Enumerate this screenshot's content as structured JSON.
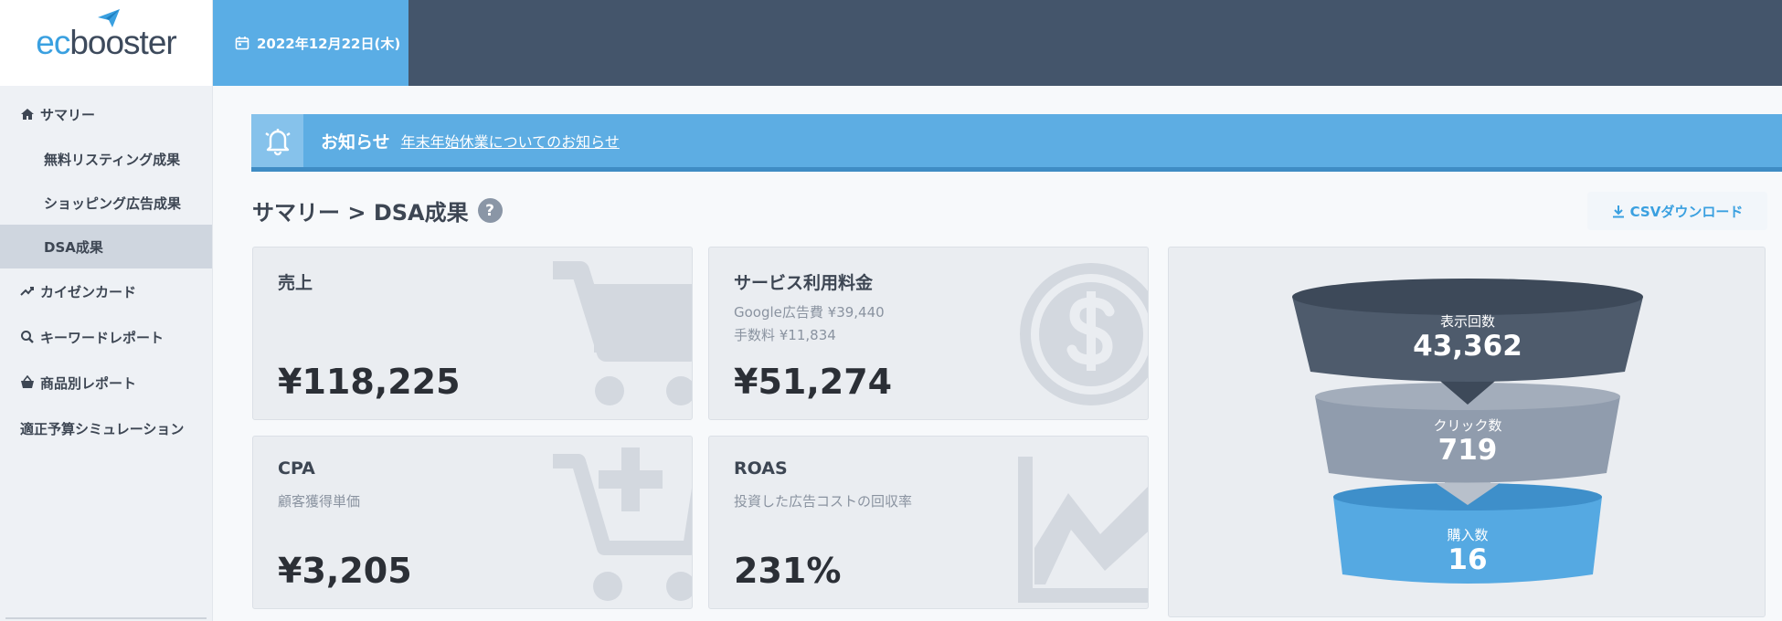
{
  "logo": {
    "part1": "ec",
    "part2": "booster"
  },
  "header": {
    "date": "2022年12月22日(木)"
  },
  "sidebar": {
    "items": [
      {
        "label": "サマリー",
        "icon": "home-icon"
      },
      {
        "label": "無料リスティング成果"
      },
      {
        "label": "ショッピング広告成果"
      },
      {
        "label": "DSA成果",
        "active": true
      },
      {
        "label": "カイゼンカード",
        "icon": "trend-icon"
      },
      {
        "label": "キーワードレポート",
        "icon": "search-icon"
      },
      {
        "label": "商品別レポート",
        "icon": "basket-icon"
      },
      {
        "label": "適正予算シミュレーション"
      }
    ]
  },
  "notice": {
    "title": "お知らせ",
    "link": "年末年始休業についてのお知らせ"
  },
  "page": {
    "title": "サマリー > DSA成果",
    "help": "?",
    "csv_label": "CSVダウンロード"
  },
  "cards": {
    "sales": {
      "label": "売上",
      "value": "¥118,225"
    },
    "service": {
      "label": "サービス利用料金",
      "sub1": "Google広告費 ¥39,440",
      "sub2": "手数料 ¥11,834",
      "value": "¥51,274"
    },
    "cpa": {
      "label": "CPA",
      "sub1": "顧客獲得単価",
      "value": "¥3,205"
    },
    "roas": {
      "label": "ROAS",
      "sub1": "投資した広告コストの回収率",
      "value": "231%"
    }
  },
  "funnel": {
    "impressions": {
      "label": "表示回数",
      "value": "43,362"
    },
    "clicks": {
      "label": "クリック数",
      "value": "719"
    },
    "purchases": {
      "label": "購入数",
      "value": "16"
    }
  },
  "colors": {
    "sidebar_bg": "#eef1f5",
    "topbar": "#44556b",
    "accent": "#5aade5",
    "funnel_top": "#4e5b6c",
    "funnel_mid": "#909cad",
    "funnel_bottom": "#55a9e2"
  }
}
